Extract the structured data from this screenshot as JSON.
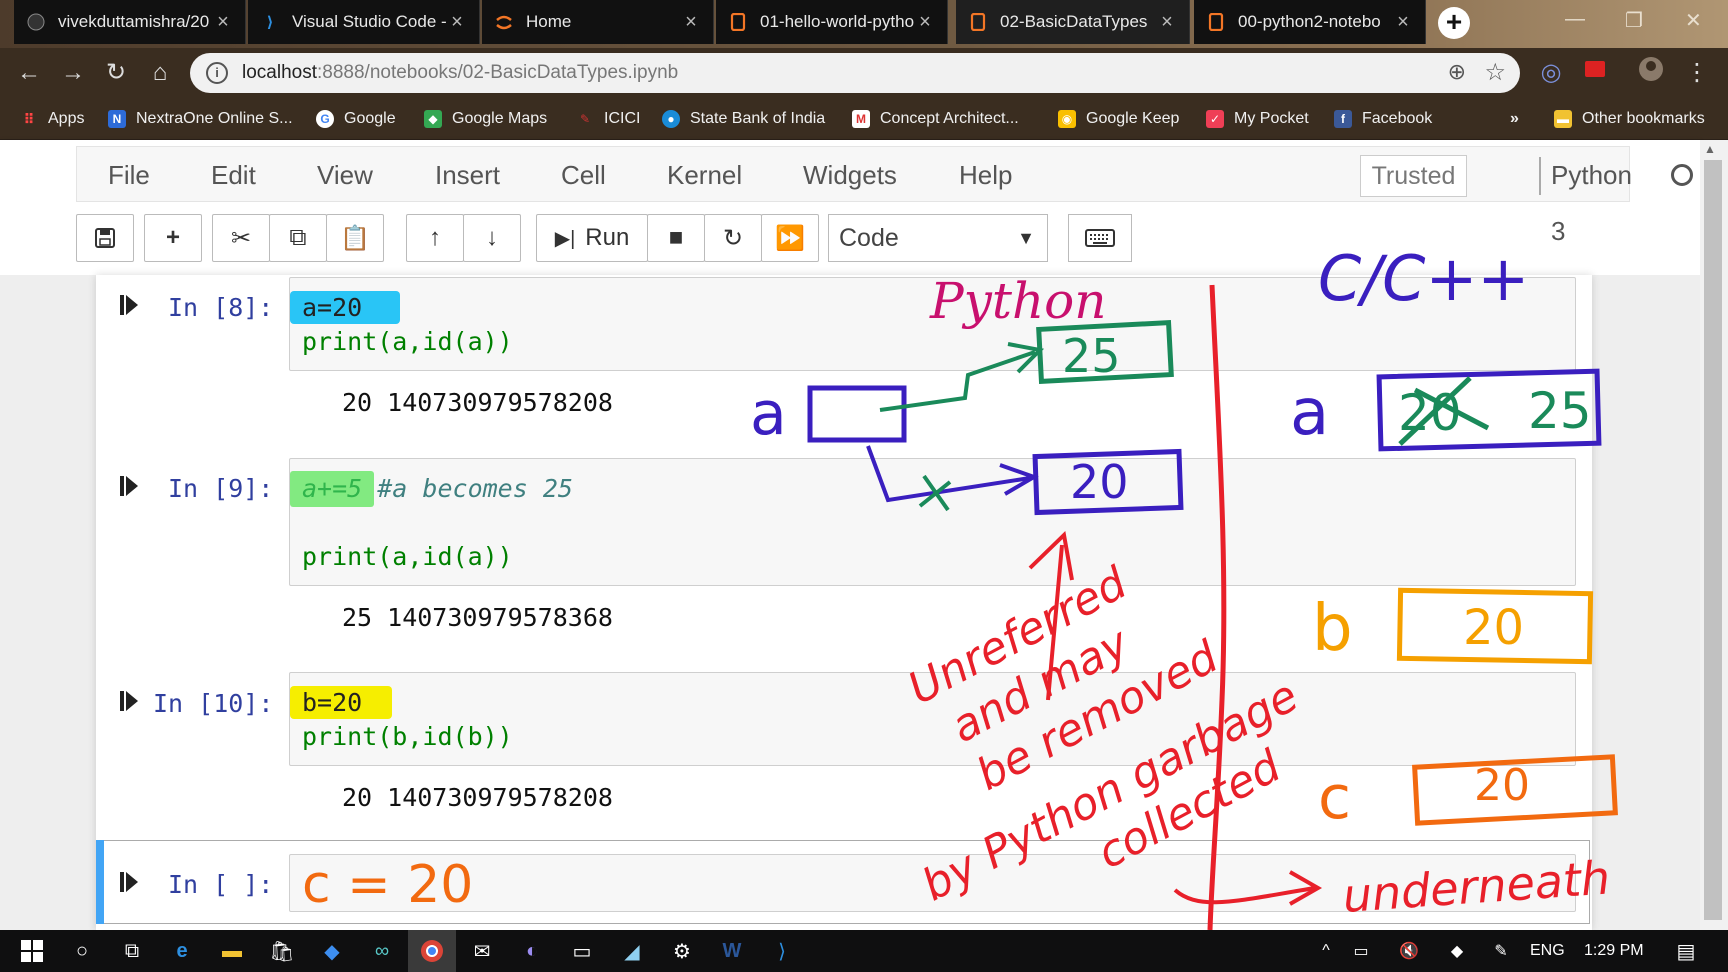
{
  "browser": {
    "tabs": [
      {
        "title": "vivekduttamishra/20",
        "icon": "github-icon"
      },
      {
        "title": "Visual Studio Code -",
        "icon": "vscode-icon"
      },
      {
        "title": "Home",
        "icon": "jupyter-icon"
      },
      {
        "title": "01-hello-world-pytho",
        "icon": "notebook-icon"
      },
      {
        "title": "02-BasicDataTypes",
        "icon": "notebook-icon",
        "active": true
      },
      {
        "title": "00-python2-notebo",
        "icon": "notebook-icon"
      }
    ],
    "url_host": "localhost",
    "url_path": ":8888/notebooks/02-BasicDataTypes.ipynb",
    "bookmarks": [
      {
        "label": "Apps"
      },
      {
        "label": "NextraOne Online S..."
      },
      {
        "label": "Google"
      },
      {
        "label": "Google Maps"
      },
      {
        "label": "ICICI"
      },
      {
        "label": "State Bank of India"
      },
      {
        "label": "Concept Architect..."
      },
      {
        "label": "Google Keep"
      },
      {
        "label": "My Pocket"
      },
      {
        "label": "Facebook"
      },
      {
        "label": "»"
      },
      {
        "label": "Other bookmarks"
      }
    ]
  },
  "jupyter": {
    "menu": [
      "File",
      "Edit",
      "View",
      "Insert",
      "Cell",
      "Kernel",
      "Widgets",
      "Help"
    ],
    "trusted": "Trusted",
    "kernel": "Python 3",
    "run_label": "Run",
    "cell_type": "Code"
  },
  "cells": [
    {
      "prompt": "In [8]:",
      "code": [
        "a=20",
        "print(a,id(a))"
      ],
      "output": "20 140730979578208"
    },
    {
      "prompt": "In [9]:",
      "code": [
        "a+=5 #a becomes 25",
        "",
        "print(a,id(a))"
      ],
      "output": "25 140730979578368"
    },
    {
      "prompt": "In [10]:",
      "code": [
        "b=20",
        "print(b,id(b))"
      ],
      "output": "20 140730979578208"
    },
    {
      "prompt": "In [ ]:",
      "code": []
    }
  ],
  "annotations": {
    "python_label": "Python",
    "cpp_label": "C/C++",
    "var_a": "a",
    "box_25": "25",
    "box_20": "20",
    "crossed": "20",
    "var_b": "b",
    "var_c": "c",
    "cell_c": "c = 20",
    "note_lines": [
      "Unreferred",
      "and may",
      "be removed",
      "by Python garbage",
      "collected"
    ],
    "underneath": "underneath",
    "colors": {
      "purple": "#3a1fbf",
      "green": "#1a8a5a",
      "red": "#e8202a",
      "orange": "#f5a000",
      "orange2": "#f26a10",
      "magenta": "#c8106e"
    }
  },
  "taskbar": {
    "lang": "ENG",
    "time": "1:29 PM"
  }
}
